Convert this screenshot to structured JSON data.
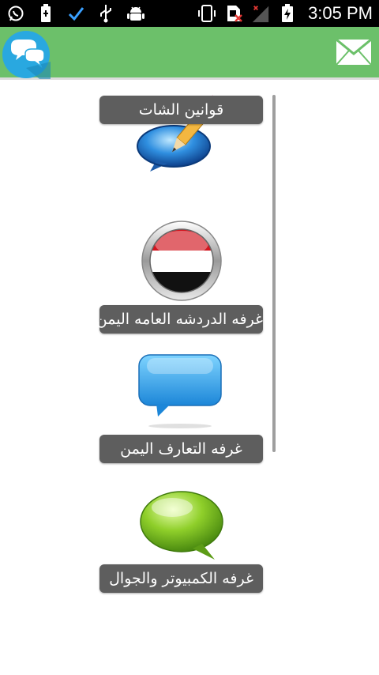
{
  "status_bar": {
    "time": "3:05 PM",
    "icons_left": [
      "whatsapp-icon",
      "battery-saver-icon",
      "check-icon",
      "usb-icon",
      "android-debug-icon"
    ],
    "icons_right": [
      "vibrate-icon",
      "sim-error-icon",
      "signal-icon",
      "battery-charging-icon"
    ]
  },
  "app_bar": {
    "logo_icon": "chat-bubbles-icon",
    "action_icon": "mail-icon",
    "color": "#6cc06a"
  },
  "menu": {
    "items": [
      {
        "label": "قوانين الشات",
        "icon": "pencil-chat-icon"
      },
      {
        "label": "غرفه الدردشه العامه اليمن",
        "icon": "yemen-flag-icon"
      },
      {
        "label": "غرفه التعارف اليمن",
        "icon": "blue-chat-bubble-icon"
      },
      {
        "label": "غرفه الكمبيوتر والجوال",
        "icon": "green-chat-bubble-icon"
      }
    ]
  }
}
